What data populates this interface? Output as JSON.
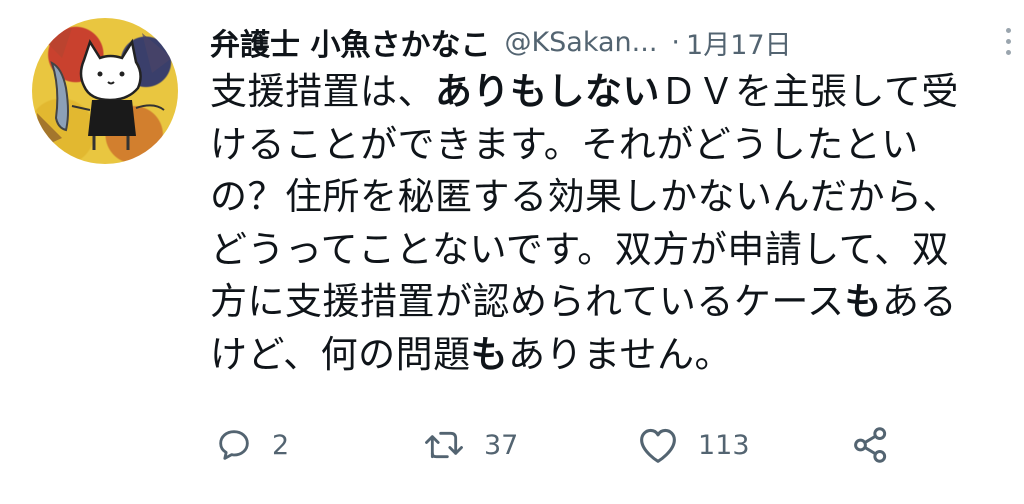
{
  "tweet": {
    "author_name": "弁護士 小魚さかなこ",
    "handle": "@KSakan...",
    "separator": "·",
    "date": "1月17日",
    "text_lines": [
      [
        {
          "t": "支援措置は、"
        },
        {
          "t": "ありもしない",
          "b": true
        },
        {
          "t": "ＤＶを主張して受"
        }
      ],
      [
        {
          "t": "けることができます。それがどうしたとい"
        }
      ],
      [
        {
          "t": "の？住所を秘匿する効果しかないんだから、"
        }
      ],
      [
        {
          "t": "どうってことないです。双方が申請して、双"
        }
      ],
      [
        {
          "t": "方に支援措置が認められているケース"
        },
        {
          "t": "も",
          "b": true
        },
        {
          "t": "ある"
        }
      ],
      [
        {
          "t": "けど、何の問題"
        },
        {
          "t": "も",
          "b": true
        },
        {
          "t": "ありません。"
        }
      ]
    ]
  },
  "actions": {
    "reply_count": "2",
    "retweet_count": "37",
    "like_count": "113"
  },
  "colors": {
    "text": "#0f1419",
    "secondary": "#536471"
  },
  "icons": [
    "reply-icon",
    "retweet-icon",
    "like-icon",
    "share-icon",
    "more-icon"
  ]
}
